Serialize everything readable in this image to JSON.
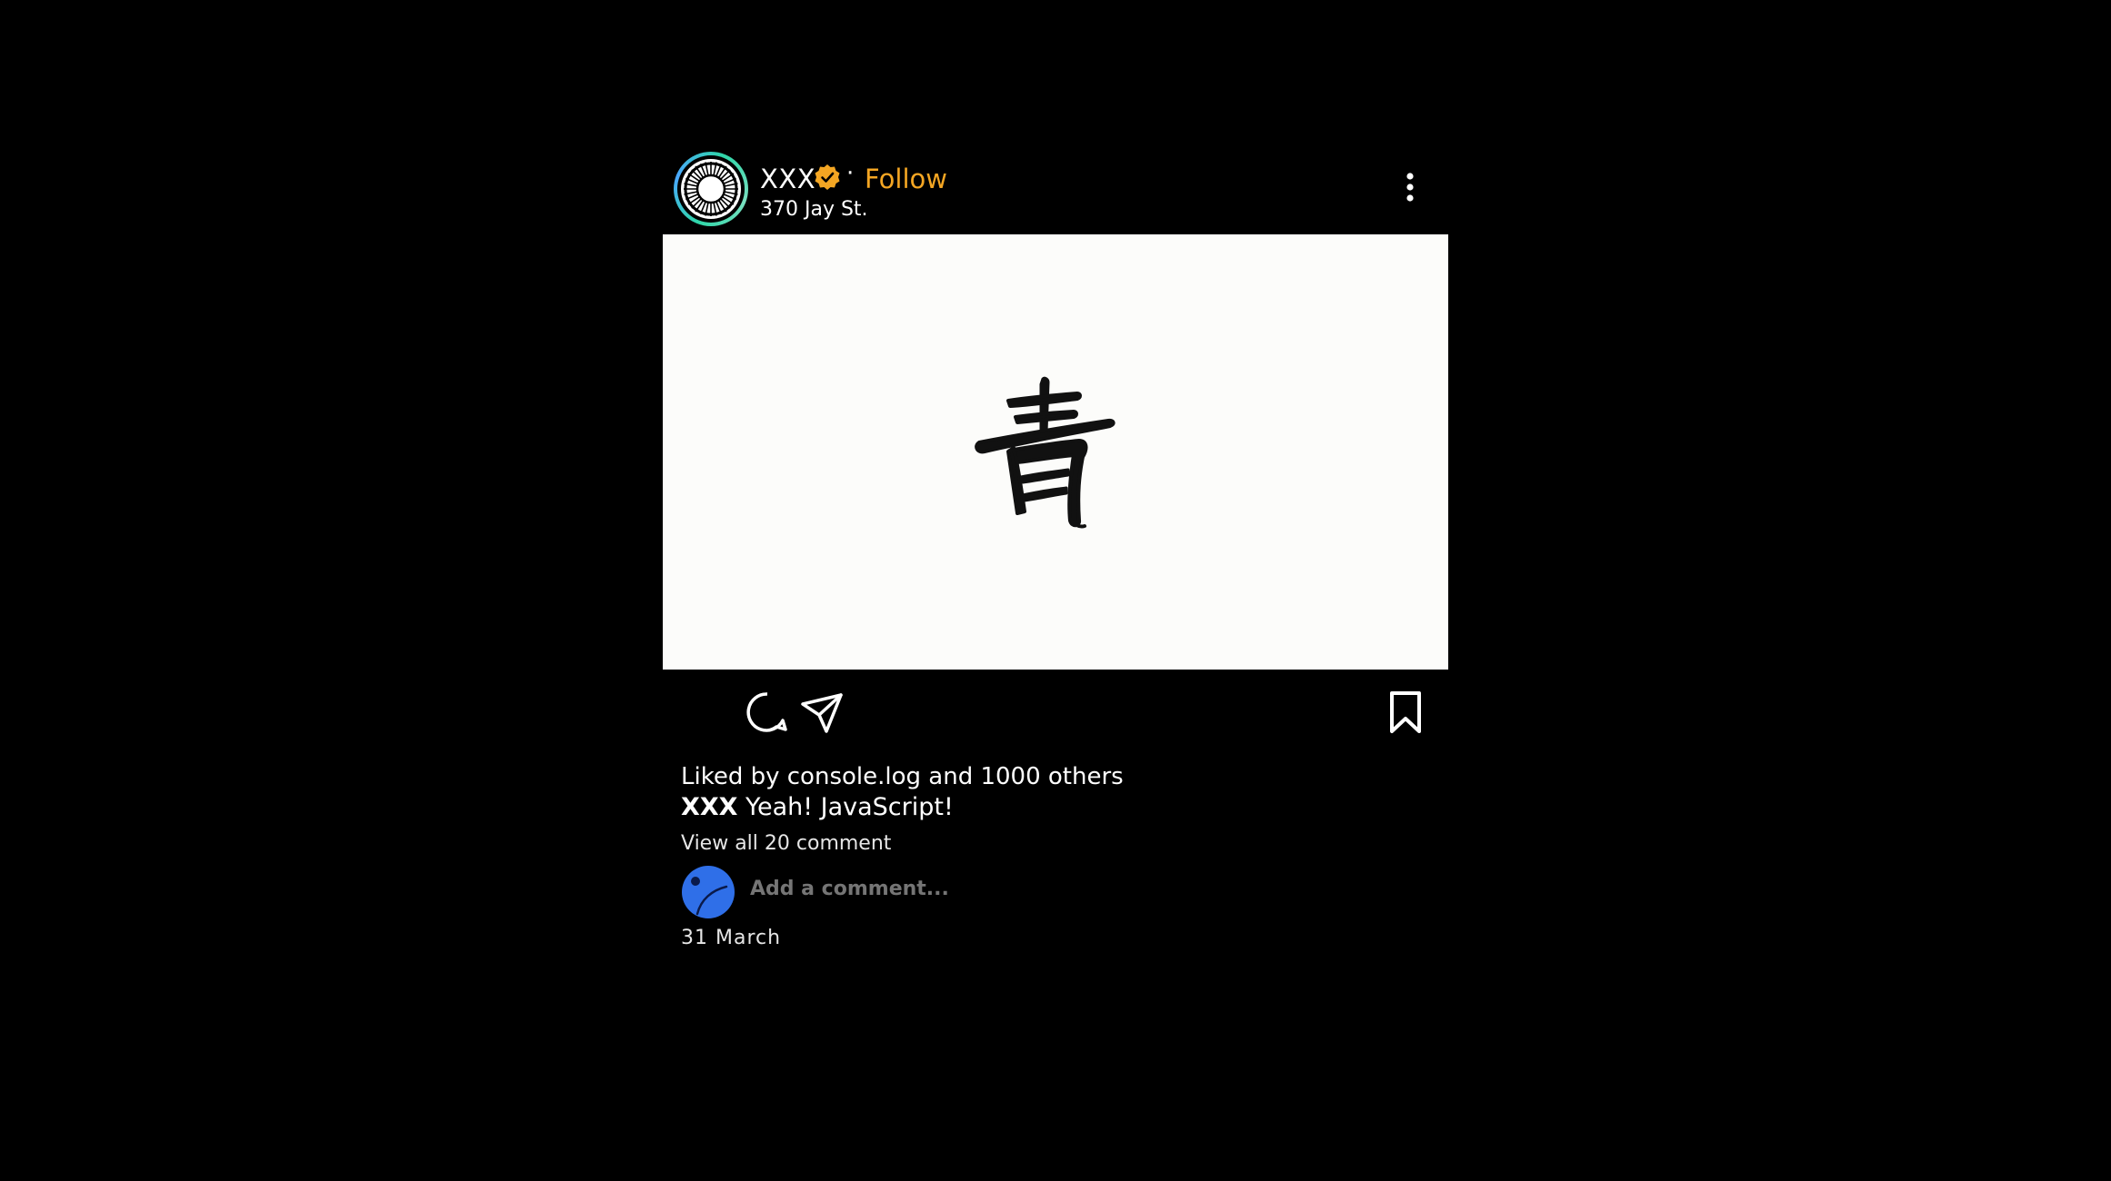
{
  "post": {
    "username": "XXX",
    "follow_label": "Follow",
    "separator": "·",
    "location": "370 Jay St.",
    "image_character": "青",
    "likes_text": "Liked by console.log and 1000 others",
    "caption_user": "XXX",
    "caption_text": "Yeah! JavaScript!",
    "view_comments": "View all 20 comment",
    "add_comment_placeholder": "Add a comment...",
    "date": "31 March"
  },
  "icons": {
    "avatar": "avatar-ring-icon",
    "verified": "verified-badge-icon",
    "more": "more-vertical-icon",
    "comment": "comment-icon",
    "share": "share-icon",
    "save": "bookmark-icon",
    "commenter": "user-avatar-icon"
  },
  "colors": {
    "background": "#000000",
    "follow": "#f4a623",
    "verified": "#f4a623",
    "image_bg": "#fcfcfa",
    "commenter_avatar": "#2f6fe8"
  }
}
